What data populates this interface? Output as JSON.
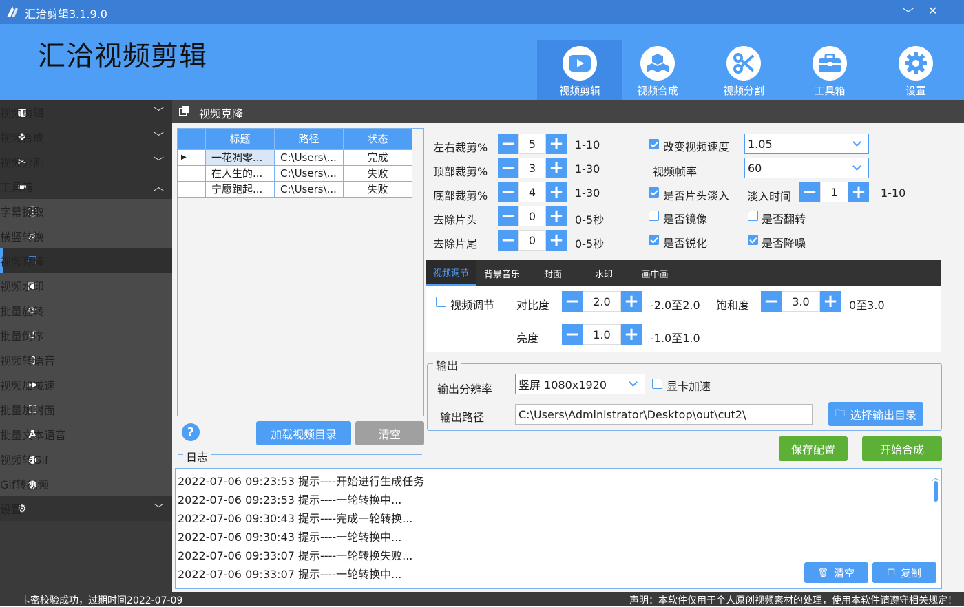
{
  "window": {
    "title": "汇洽剪辑3.1.9.0",
    "minimize_glyph": "﹀",
    "close_glyph": "✕"
  },
  "header": {
    "brand": "汇洽视频剪辑",
    "nav": [
      {
        "label": "视频剪辑",
        "icon": "play-icon",
        "active": true
      },
      {
        "label": "视频合成",
        "icon": "cubes-icon",
        "active": false
      },
      {
        "label": "视频分割",
        "icon": "scissors-icon",
        "active": false
      },
      {
        "label": "工具箱",
        "icon": "toolbox-icon",
        "active": false
      },
      {
        "label": "设置",
        "icon": "gear-icon",
        "active": false
      }
    ]
  },
  "sidebar": {
    "top": [
      {
        "label": "视频剪辑",
        "icon": "video-camera-icon",
        "chevron": "down"
      },
      {
        "label": "视频合成",
        "icon": "cubes-icon",
        "chevron": "down"
      },
      {
        "label": "视频分割",
        "icon": "scissors-icon",
        "chevron": "down"
      },
      {
        "label": "工具箱",
        "icon": "toolbox-icon",
        "chevron": "up"
      }
    ],
    "tools": [
      {
        "label": "字幕提取",
        "icon": "subtitle-icon",
        "glyph": "ⓣ"
      },
      {
        "label": "横竖转换",
        "icon": "swap-icon",
        "glyph": "⇄"
      },
      {
        "label": "视频克隆",
        "icon": "clone-icon",
        "glyph": "❐",
        "selected": true
      },
      {
        "label": "视频水印",
        "icon": "watermark-icon",
        "glyph": "▣"
      },
      {
        "label": "批量旋转",
        "icon": "rotate-icon",
        "glyph": "⟳"
      },
      {
        "label": "批量倒序",
        "icon": "history-icon",
        "glyph": "↺"
      },
      {
        "label": "视频转语音",
        "icon": "music-icon",
        "glyph": "♫"
      },
      {
        "label": "视频加减速",
        "icon": "fast-forward-icon",
        "glyph": "▶▶"
      },
      {
        "label": "批量加封面",
        "icon": "cover-icon",
        "glyph": "⛶"
      },
      {
        "label": "批量文本语音",
        "icon": "text-icon",
        "glyph": "A"
      },
      {
        "label": "视频转Gif",
        "icon": "user-icon",
        "glyph": "●"
      },
      {
        "label": "Gif转视频",
        "icon": "user-icon",
        "glyph": "●"
      }
    ],
    "settings": {
      "label": "设置",
      "icon": "gear-icon",
      "chevron": "down"
    }
  },
  "panel": {
    "title": "视频克隆"
  },
  "grid": {
    "columns": [
      "标题",
      "路径",
      "状态"
    ],
    "rows": [
      {
        "title": "一花凋零...",
        "path": "C:\\Users\\...",
        "status": "完成"
      },
      {
        "title": "在人生的...",
        "path": "C:\\Users\\...",
        "status": "失败"
      },
      {
        "title": "宁愿跑起...",
        "path": "C:\\Users\\...",
        "status": "失败"
      }
    ]
  },
  "buttons": {
    "load_dir": "加载视频目录",
    "clear": "清空",
    "save_config": "保存配置",
    "start": "开始合成",
    "choose_output": "选择输出目录",
    "help": "?"
  },
  "crop": [
    {
      "label": "左右裁剪%",
      "value": "5",
      "range": "1-10"
    },
    {
      "label": "顶部裁剪%",
      "value": "3",
      "range": "1-30"
    },
    {
      "label": "底部裁剪%",
      "value": "4",
      "range": "1-30"
    },
    {
      "label": "去除片头",
      "value": "0",
      "range": "0-5秒"
    },
    {
      "label": "去除片尾",
      "value": "0",
      "range": "0-5秒"
    }
  ],
  "options": {
    "change_speed": {
      "label": "改变视频速度",
      "checked": true
    },
    "speed_value": "1.05",
    "fps_label": "视频帧率",
    "fps_value": "60",
    "fade_in": {
      "label": "是否片头淡入",
      "checked": true
    },
    "fade_time_label": "淡入时间",
    "fade_time_value": "1",
    "fade_time_range": "1-10",
    "mirror": {
      "label": "是否镜像",
      "checked": false
    },
    "flip": {
      "label": "是否翻转",
      "checked": false
    },
    "sharpen": {
      "label": "是否锐化",
      "checked": true
    },
    "denoise": {
      "label": "是否降噪",
      "checked": true
    }
  },
  "tabs": [
    "视频调节",
    "背景音乐",
    "封面",
    "水印",
    "画中画"
  ],
  "adjust": {
    "enable": {
      "label": "视频调节",
      "checked": false
    },
    "contrast": {
      "label": "对比度",
      "value": "2.0",
      "range": "-2.0至2.0"
    },
    "saturation": {
      "label": "饱和度",
      "value": "3.0",
      "range": "0至3.0"
    },
    "brightness": {
      "label": "亮度",
      "value": "1.0",
      "range": "-1.0至1.0"
    }
  },
  "output": {
    "legend": "输出",
    "resolution_label": "输出分辨率",
    "resolution_value": "竖屏  1080x1920",
    "gpu": {
      "label": "显卡加速",
      "checked": false
    },
    "path_label": "输出路径",
    "path_value": "C:\\Users\\Administrator\\Desktop\\out\\cut2\\"
  },
  "log": {
    "legend": "日志",
    "lines": [
      "2022-07-06 09:23:53 提示----开始进行生成任务",
      "2022-07-06 09:23:53 提示----一轮转换中...",
      "2022-07-06 09:30:43 提示----完成一轮转换...",
      "2022-07-06 09:30:43 提示----一轮转换中...",
      "2022-07-06 09:33:07 提示----一轮转换失败...",
      "2022-07-06 09:33:07 提示----一轮转换中..."
    ],
    "clear": "清空",
    "copy": "复制"
  },
  "status": {
    "left": "卡密校验成功，过期时间2022-07-09",
    "right": "声明：本软件仅用于个人原创视频素材的处理，使用本软件请遵守相关规定！"
  },
  "colors": {
    "accent": "#4f9ef5",
    "header": "#4f9ef5",
    "sidebar": "#3a3a3a",
    "green": "#5cb036"
  }
}
